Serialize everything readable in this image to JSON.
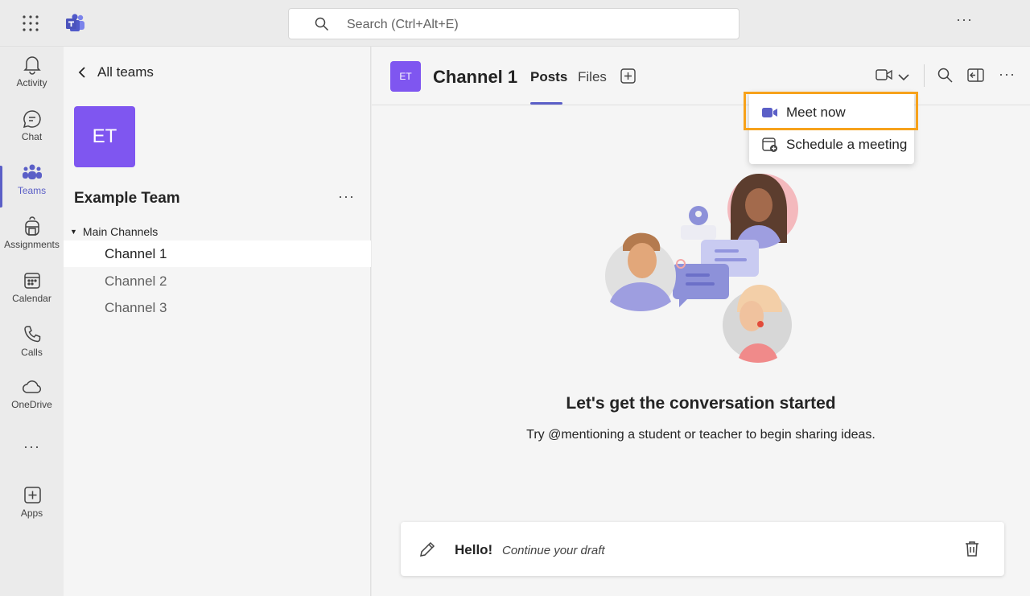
{
  "app": {
    "search_placeholder": "Search (Ctrl+Alt+E)",
    "more_label": "···",
    "accent_color": "#5b5fc7",
    "team_color": "#7f56f0",
    "highlight_color": "#f7a21b"
  },
  "rail": {
    "items": [
      {
        "label": "Activity",
        "icon": "bell-icon"
      },
      {
        "label": "Chat",
        "icon": "chat-icon"
      },
      {
        "label": "Teams",
        "icon": "teams-icon",
        "active": true
      },
      {
        "label": "Assignments",
        "icon": "backpack-icon"
      },
      {
        "label": "Calendar",
        "icon": "calendar-icon"
      },
      {
        "label": "Calls",
        "icon": "phone-icon"
      },
      {
        "label": "OneDrive",
        "icon": "cloud-icon"
      },
      {
        "label": "Apps",
        "icon": "add-square-icon"
      }
    ],
    "more_label": "···"
  },
  "sidebar": {
    "back_label": "All teams",
    "team_initials": "ET",
    "team_name": "Example Team",
    "more_label": "···",
    "section_label": "Main Channels",
    "channels": [
      "Channel 1",
      "Channel 2",
      "Channel 3"
    ]
  },
  "header": {
    "channel_initials": "ET",
    "channel_title": "Channel 1",
    "tabs": [
      "Posts",
      "Files"
    ],
    "more_label": "···"
  },
  "meet_menu": {
    "items": [
      "Meet now",
      "Schedule a meeting"
    ]
  },
  "empty_state": {
    "title": "Let's get the conversation started",
    "subtitle": "Try @mentioning a student or teacher to begin sharing ideas."
  },
  "draft": {
    "text": "Hello!",
    "hint": "Continue your draft"
  }
}
